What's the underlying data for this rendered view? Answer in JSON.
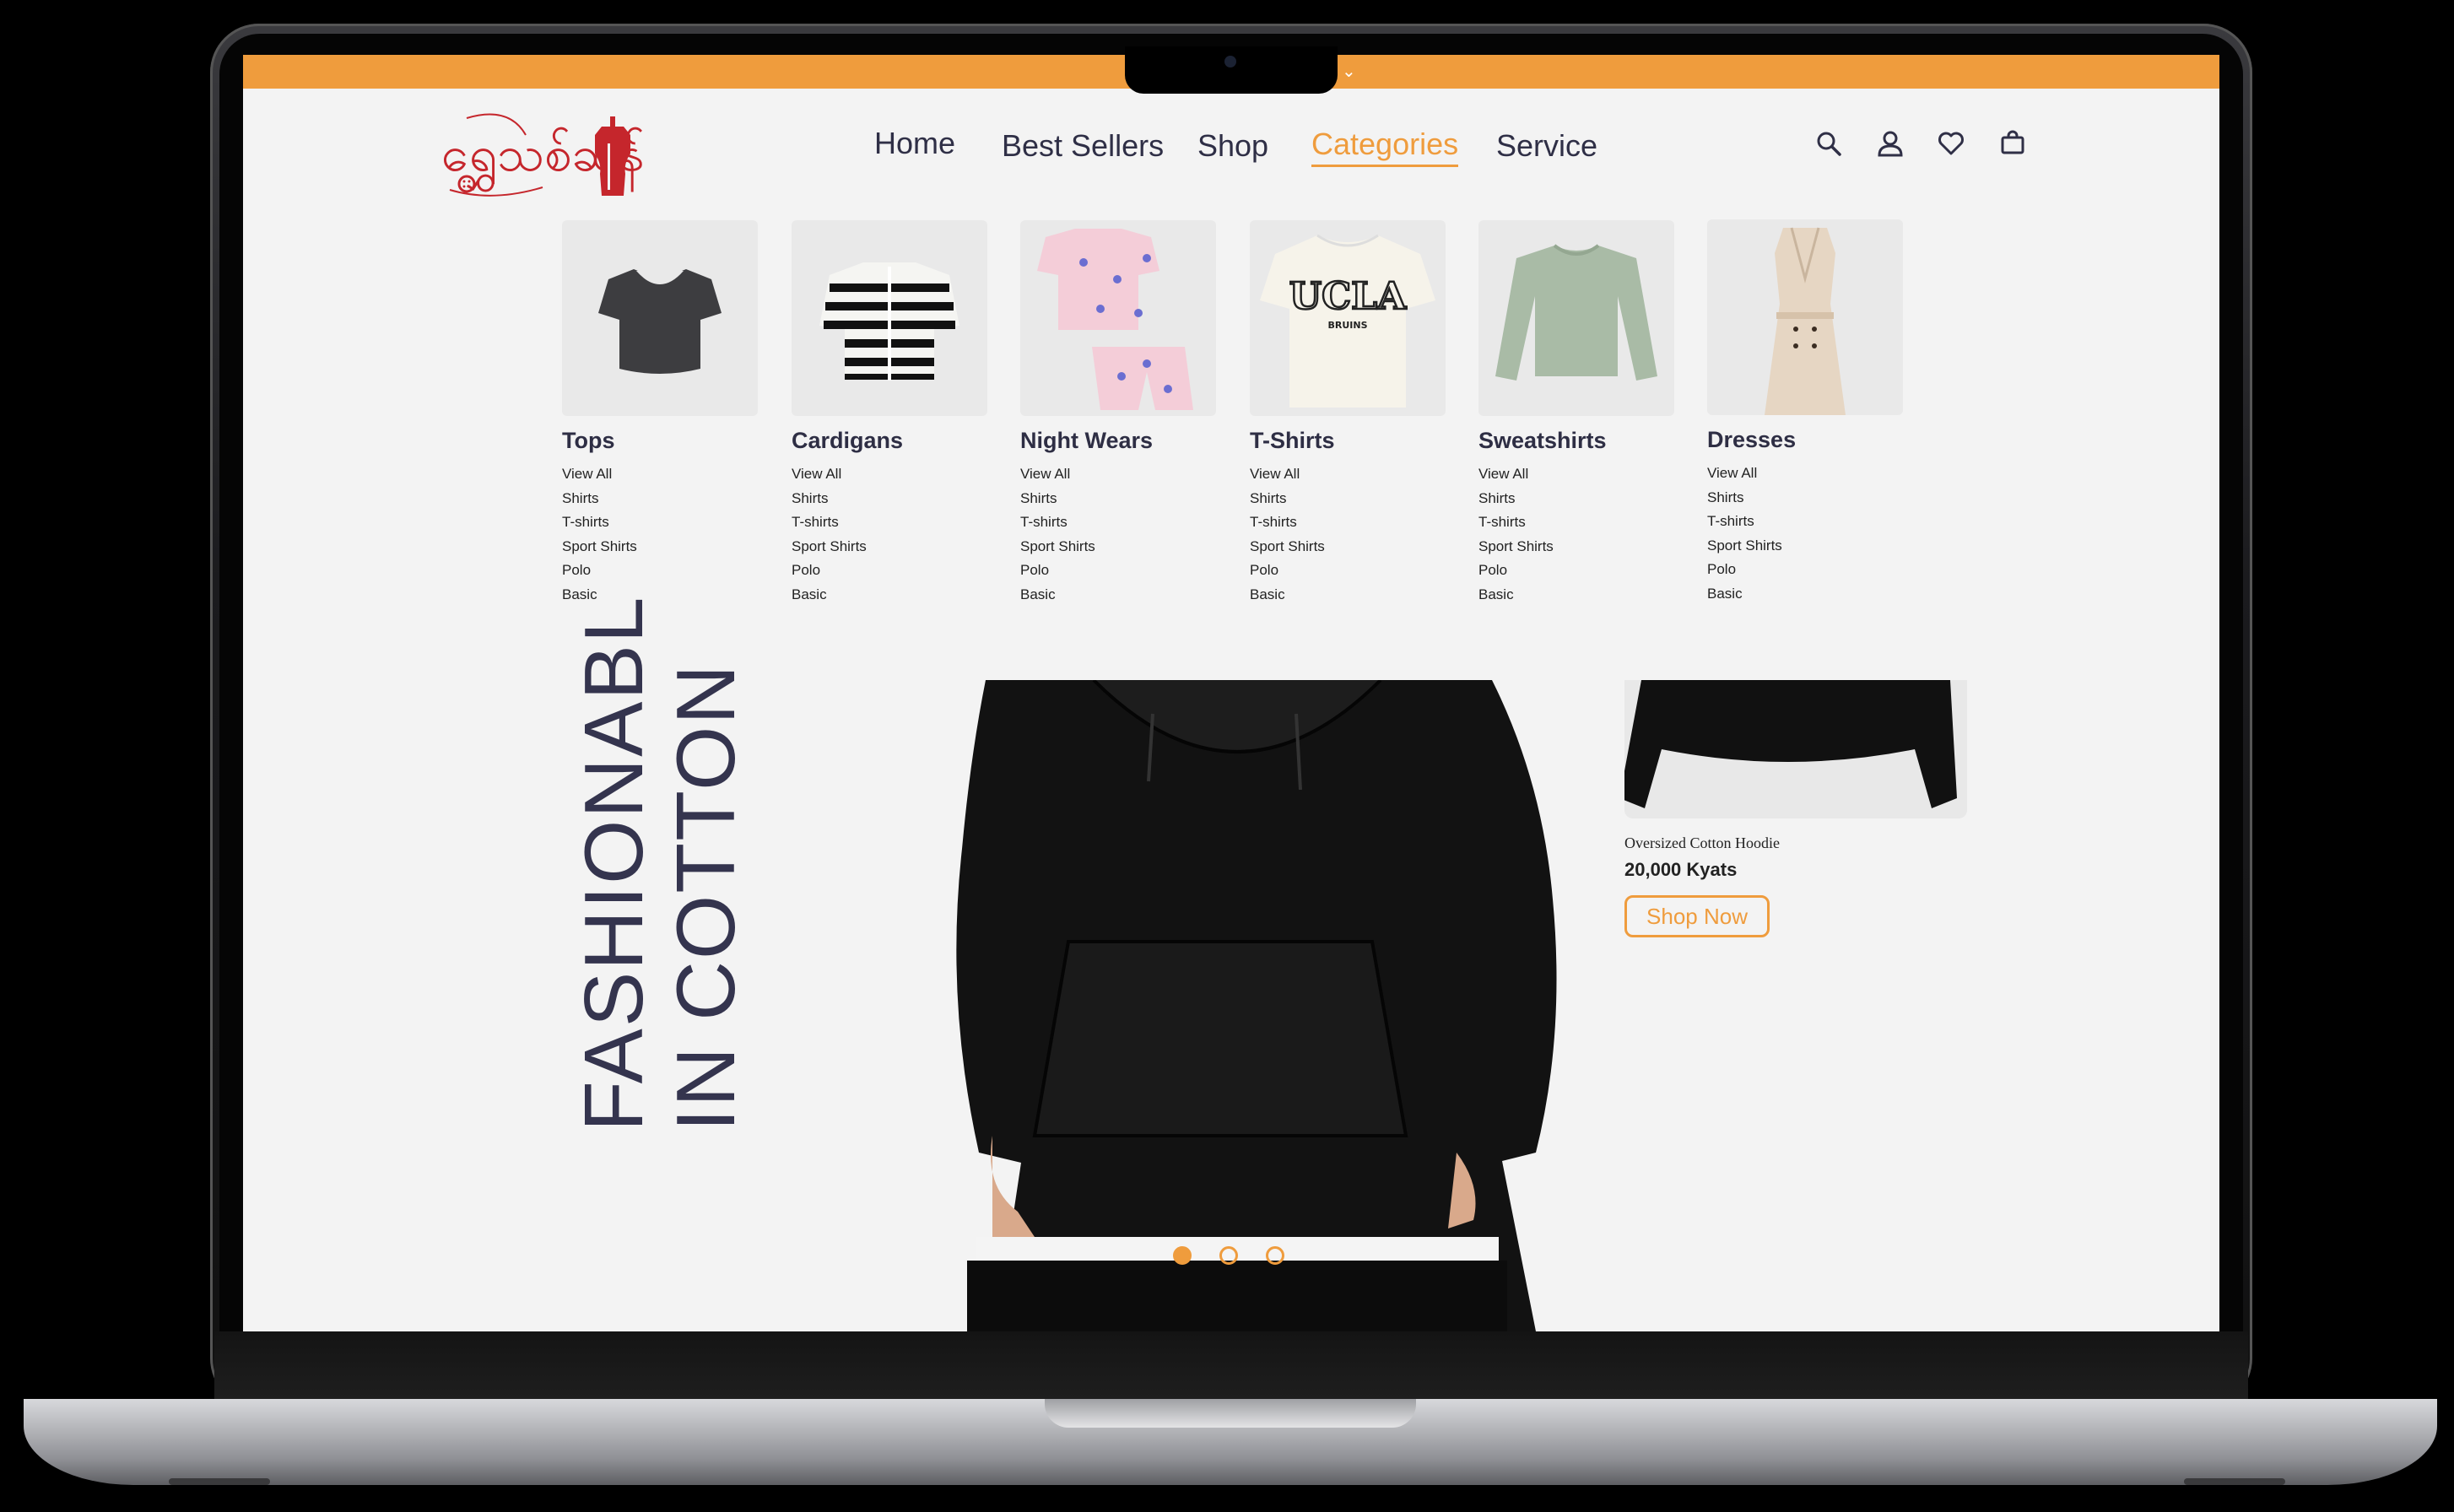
{
  "brand": {
    "logo_text": "ရွှေသစ်ဆန်း",
    "logo_icon": "tailor-dress-form-icon"
  },
  "colors": {
    "accent": "#ef9c3d",
    "text_dark": "#2f2f46",
    "screen_bg": "#f3f3f3"
  },
  "nav": {
    "items": [
      {
        "label": "Home",
        "active": false
      },
      {
        "label": "Best Sellers",
        "active": false
      },
      {
        "label": "Shop",
        "active": false
      },
      {
        "label": "Categories",
        "active": true
      },
      {
        "label": "Service",
        "active": false
      }
    ],
    "icons": [
      "search-icon",
      "user-icon",
      "heart-icon",
      "shopping-bag-icon"
    ]
  },
  "categories": [
    {
      "title": "Tops",
      "links": [
        "View All",
        "Shirts",
        "T-shirts",
        "Sport Shirts",
        "Polo",
        "Basic"
      ]
    },
    {
      "title": "Cardigans",
      "links": [
        "View All",
        "Shirts",
        "T-shirts",
        "Sport Shirts",
        "Polo",
        "Basic"
      ]
    },
    {
      "title": "Night Wears",
      "links": [
        "View All",
        "Shirts",
        "T-shirts",
        "Sport Shirts",
        "Polo",
        "Basic"
      ]
    },
    {
      "title": "T-Shirts",
      "links": [
        "View All",
        "Shirts",
        "T-shirts",
        "Sport Shirts",
        "Polo",
        "Basic"
      ]
    },
    {
      "title": "Sweatshirts",
      "links": [
        "View All",
        "Shirts",
        "T-shirts",
        "Sport Shirts",
        "Polo",
        "Basic"
      ]
    },
    {
      "title": "Dresses",
      "links": [
        "View All",
        "Shirts",
        "T-shirts",
        "Sport Shirts",
        "Polo",
        "Basic"
      ]
    }
  ],
  "hero": {
    "line1": "FASHIONABL",
    "line2": "IN COTTON",
    "tshirt_print": "UCLA",
    "tshirt_sub": "BRUINS"
  },
  "product": {
    "name": "Oversized Cotton Hoodie",
    "price": "20,000 Kyats",
    "cta": "Shop Now"
  },
  "carousel": {
    "count": 3,
    "active_index": 0
  }
}
